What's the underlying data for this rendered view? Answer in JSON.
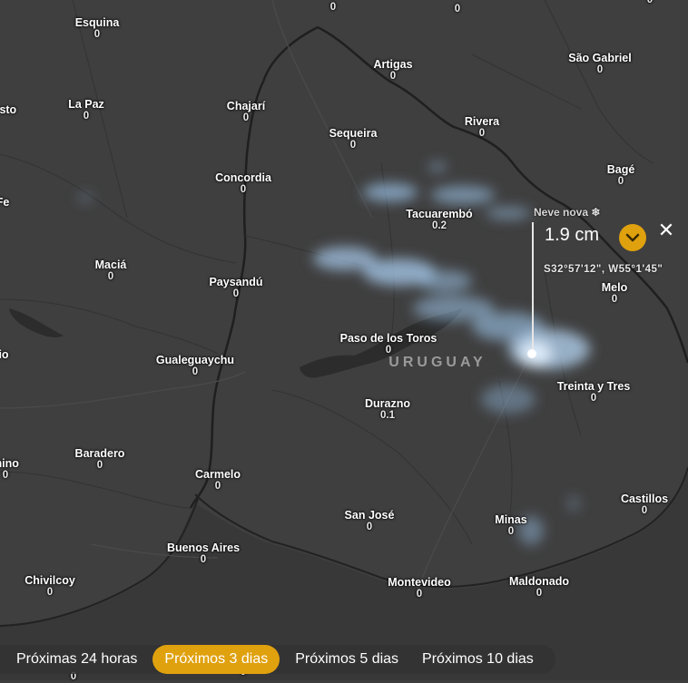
{
  "map": {
    "country": "URUGUAY",
    "cities": [
      {
        "name": "Esquina",
        "value": "0"
      },
      {
        "name": "Artigas",
        "value": "0"
      },
      {
        "name": "São Gabriel",
        "value": "0"
      },
      {
        "name": "La Paz",
        "value": "0"
      },
      {
        "name": "Chajarí",
        "value": "0"
      },
      {
        "name": "Sequeira",
        "value": "0"
      },
      {
        "name": "Rivera",
        "value": "0"
      },
      {
        "name": "Concordia",
        "value": "0"
      },
      {
        "name": "Bagé",
        "value": "0"
      },
      {
        "name": "Tacuarembó",
        "value": "0.2"
      },
      {
        "name": "Maciá",
        "value": "0"
      },
      {
        "name": "Paysandú",
        "value": "0"
      },
      {
        "name": "Melo",
        "value": "0"
      },
      {
        "name": "Paso de los Toros",
        "value": "0"
      },
      {
        "name": "Gualeguaychu",
        "value": "0"
      },
      {
        "name": "Treinta y Tres",
        "value": "0"
      },
      {
        "name": "Durazno",
        "value": "0.1"
      },
      {
        "name": "Baradero",
        "value": "0"
      },
      {
        "name": "Carmelo",
        "value": "0"
      },
      {
        "name": "Castillos",
        "value": "0"
      },
      {
        "name": "San José",
        "value": "0"
      },
      {
        "name": "Minas",
        "value": "0"
      },
      {
        "name": "Buenos Aires",
        "value": "0"
      },
      {
        "name": "Chivilcoy",
        "value": "0"
      },
      {
        "name": "Montevideo",
        "value": "0"
      },
      {
        "name": "Maldonado",
        "value": "0"
      },
      {
        "name": "usto",
        "value": ""
      },
      {
        "name": "Fe",
        "value": ""
      },
      {
        "name": "io",
        "value": ""
      },
      {
        "name": "mino",
        "value": "0"
      }
    ],
    "edge_values": [
      "0",
      "0",
      "0",
      "0",
      "0"
    ]
  },
  "popup": {
    "label": "Neve nova",
    "label_icon": "❄",
    "value": "1.9 cm",
    "coordinates": "S32°57'12\", W55°1'45\"",
    "close": "✕",
    "accent_color": "#e0a10e"
  },
  "tabs": [
    {
      "label": "Próximas 24 horas",
      "active": false
    },
    {
      "label": "Próximos 3 dias",
      "active": true
    },
    {
      "label": "Próximos 5 dias",
      "active": false
    },
    {
      "label": "Próximos 10 dias",
      "active": false
    }
  ]
}
